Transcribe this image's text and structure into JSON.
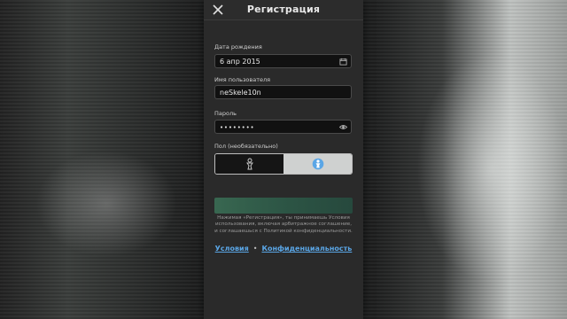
{
  "dialog": {
    "title": "Регистрация"
  },
  "birthdate": {
    "label": "Дата рождения",
    "value": "6 апр 2015",
    "icon": "calendar-icon"
  },
  "username": {
    "label": "Имя пользователя",
    "value": "neSkele10n"
  },
  "password": {
    "label": "Пароль",
    "value": "••••••••",
    "icon": "eye-icon"
  },
  "gender": {
    "label": "Пол (необязательно)",
    "options": [
      "male-icon",
      "female-icon"
    ],
    "selected_accent": "#5aa6e6"
  },
  "submit": {
    "label": ""
  },
  "disclaimer": {
    "text": "Нажимая «Регистрация», ты принимаешь Условия использования, включая арбитражное соглашение, и соглашаешься с Политикой конфиденциальности."
  },
  "links": {
    "terms": "Условия",
    "separator": "•",
    "privacy": "Конфиденциальность"
  },
  "colors": {
    "dialog_bg": "#2a2a2a",
    "submit_bg": "#2d5a48",
    "link": "#5aa6e6"
  }
}
